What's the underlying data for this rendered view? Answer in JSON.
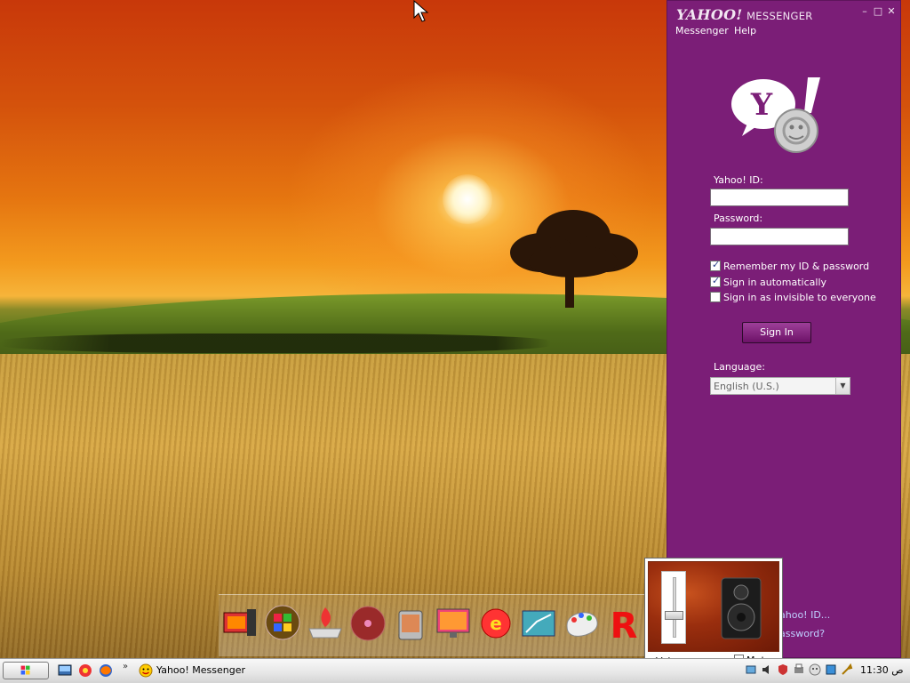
{
  "messenger": {
    "title_brand": "YAHOO!",
    "title_app": "MESSENGER",
    "menu": [
      "Messenger",
      "Help"
    ],
    "yahoo_id_label": "Yahoo! ID:",
    "yahoo_id_value": "",
    "password_label": "Password:",
    "password_value": "",
    "checkboxes": [
      {
        "label": "Remember my ID & password",
        "checked": true
      },
      {
        "label": "Sign in automatically",
        "checked": true
      },
      {
        "label": "Sign in as invisible to everyone",
        "checked": false
      }
    ],
    "sign_in_label": "Sign In",
    "language_label": "Language:",
    "language_value": "English (U.S.)",
    "link_forgot_id": "ahoo! ID...",
    "link_forgot_password": "assword?"
  },
  "volume": {
    "label": "Volume",
    "mute_label": "Mute",
    "mute_checked": false,
    "level": 0.35
  },
  "taskbar": {
    "overflow": "»",
    "task_label": "Yahoo! Messenger",
    "clock": "11:30 ص"
  },
  "colors": {
    "messenger_purple": "#7b1e77",
    "link_blue": "#bfd0ff"
  }
}
